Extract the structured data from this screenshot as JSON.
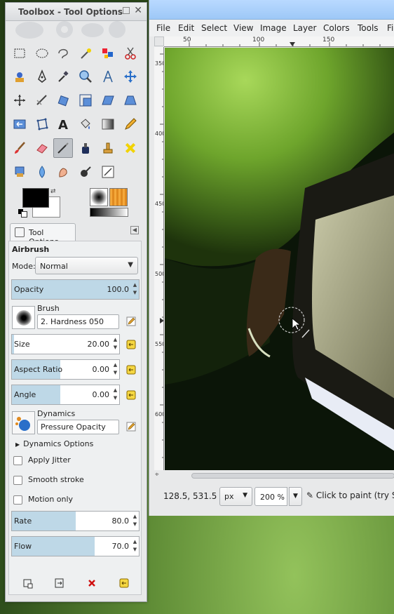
{
  "toolbox": {
    "title": "Toolbox - Tool Options",
    "tab_label": "Tool Options",
    "tool_name": "Airbrush",
    "mode_label": "Mode:",
    "mode_value": "Normal",
    "opacity": {
      "label": "Opacity",
      "value": "100.0",
      "fraction": 1.0
    },
    "brush_label": "Brush",
    "brush_name": "2. Hardness 050",
    "size": {
      "label": "Size",
      "value": "20.00",
      "fraction": 0.02
    },
    "aspect_ratio": {
      "label": "Aspect Ratio",
      "value": "0.00",
      "fraction": 0.5
    },
    "angle": {
      "label": "Angle",
      "value": "0.00",
      "fraction": 0.5
    },
    "dynamics_label": "Dynamics",
    "dynamics_name": "Pressure Opacity",
    "dynamics_options": "Dynamics Options",
    "apply_jitter": "Apply Jitter",
    "smooth_stroke": "Smooth stroke",
    "motion_only": "Motion only",
    "rate": {
      "label": "Rate",
      "value": "80.0",
      "fraction": 0.5
    },
    "flow": {
      "label": "Flow",
      "value": "70.0",
      "fraction": 0.65
    }
  },
  "image_window": {
    "menus": [
      "File",
      "Edit",
      "Select",
      "View",
      "Image",
      "Layer",
      "Colors",
      "Tools",
      "Fil"
    ],
    "ruler_h": [
      "50",
      "100",
      "150"
    ],
    "ruler_v": [
      "350",
      "400",
      "450",
      "500",
      "550",
      "600"
    ],
    "coords": "128.5, 531.5",
    "unit": "px",
    "zoom": "200 %",
    "status_message": "Click to paint (try Sh"
  }
}
